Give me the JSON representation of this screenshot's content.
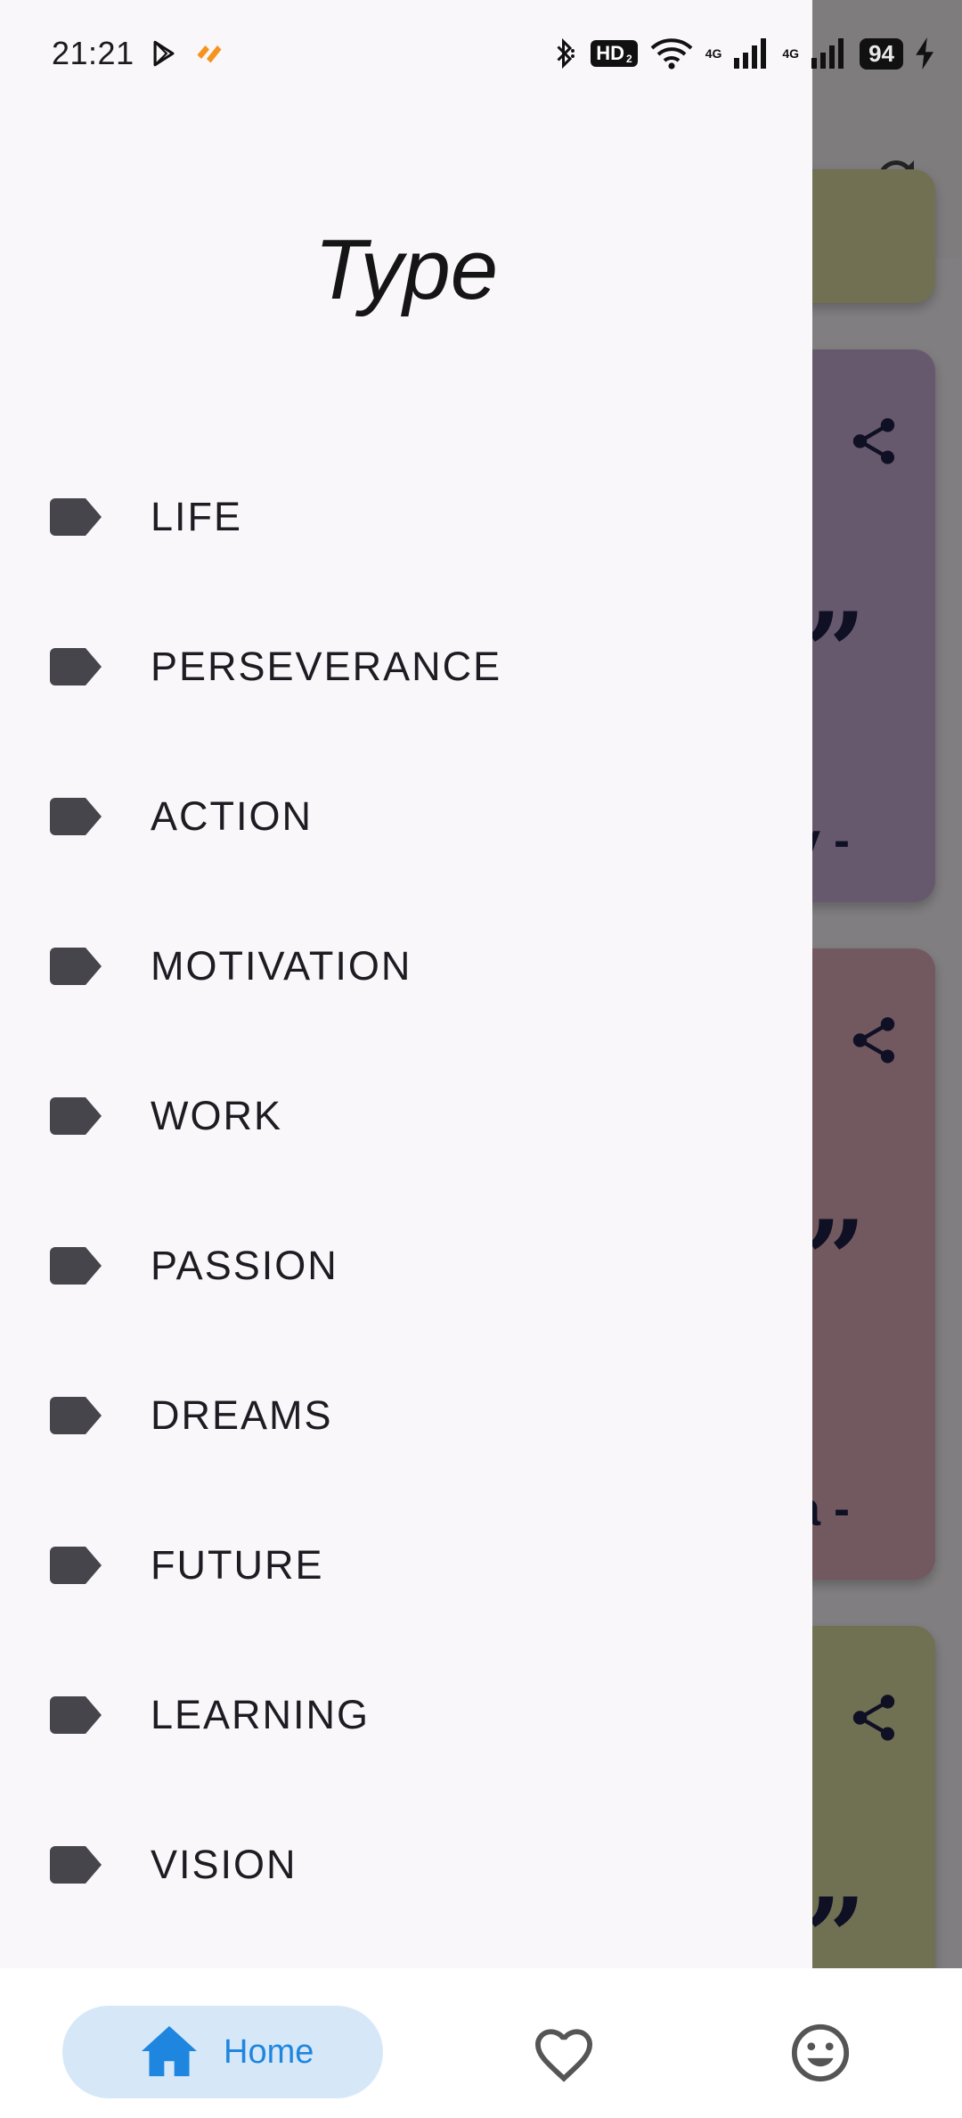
{
  "status_bar": {
    "time": "21:21",
    "hd_label": "HD",
    "hd_sub": "2",
    "network_1": "4G",
    "network_2": "4G",
    "battery": "94",
    "icons": [
      "play-store-icon",
      "app-notification-icon",
      "bluetooth-icon",
      "wifi-icon",
      "signal-icon",
      "charging-icon"
    ]
  },
  "background": {
    "refresh_icon": "refresh-icon",
    "cards": [
      {
        "author_tail": "",
        "color": "#d8d59a"
      },
      {
        "author_tail": "y -",
        "color": "#c3a6cf"
      },
      {
        "author_tail": "a -",
        "color": "#d9a3b2"
      },
      {
        "author_tail": "",
        "color": "#d6d59a"
      }
    ]
  },
  "drawer": {
    "title": "Type",
    "items": [
      {
        "label": "LIFE"
      },
      {
        "label": "PERSEVERANCE"
      },
      {
        "label": "ACTION"
      },
      {
        "label": "MOTIVATION"
      },
      {
        "label": "WORK"
      },
      {
        "label": "PASSION"
      },
      {
        "label": "DREAMS"
      },
      {
        "label": "FUTURE"
      },
      {
        "label": "LEARNING"
      },
      {
        "label": "VISION"
      }
    ],
    "item_icon": "label-tag-icon"
  },
  "bottom_nav": {
    "home_label": "Home",
    "accent": "#1f86e0",
    "active_bg": "#d6e8f8",
    "icons": [
      "home-icon",
      "heart-icon",
      "smiley-icon"
    ]
  }
}
